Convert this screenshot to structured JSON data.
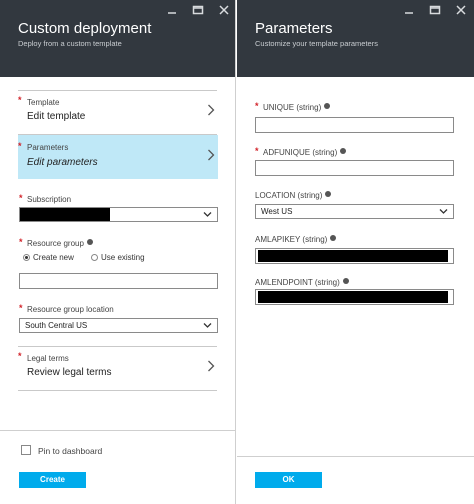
{
  "left_blade": {
    "title": "Custom deployment",
    "subtitle": "Deploy from a custom template",
    "items": [
      {
        "label": "Template",
        "value": "Edit template"
      },
      {
        "label": "Parameters",
        "value": "Edit parameters"
      }
    ],
    "subscription": {
      "label": "Subscription",
      "value": "[redacted]"
    },
    "resource_group": {
      "label": "Resource group",
      "options": [
        "Create new",
        "Use existing"
      ],
      "selected": "Create new",
      "input_value": ""
    },
    "location": {
      "label": "Resource group location",
      "value": "South Central US"
    },
    "legal": {
      "label": "Legal terms",
      "value": "Review legal terms"
    },
    "pin_label": "Pin to dashboard",
    "pin_checked": false,
    "create_label": "Create"
  },
  "right_blade": {
    "title": "Parameters",
    "subtitle": "Customize your template parameters",
    "fields": [
      {
        "label": "UNIQUE (string)",
        "required": true,
        "value": ""
      },
      {
        "label": "ADFUNIQUE (string)",
        "required": true,
        "value": ""
      },
      {
        "label": "LOCATION (string)",
        "required": false,
        "value": "West US"
      },
      {
        "label": "AMLAPIKEY (string)",
        "required": false,
        "value": "[redacted]"
      },
      {
        "label": "AMLENDPOINT (string)",
        "required": false,
        "value": "[redacted]"
      }
    ],
    "ok_label": "OK"
  },
  "colors": {
    "header_bg": "#32383f",
    "selected_item_bg": "#bfe8f7",
    "button_bg": "#00abec",
    "required_star": "#d2232a"
  },
  "icons": [
    "minimize-icon",
    "maximize-icon",
    "close-icon",
    "chevron-right-icon",
    "chevron-down-icon",
    "info-icon"
  ]
}
